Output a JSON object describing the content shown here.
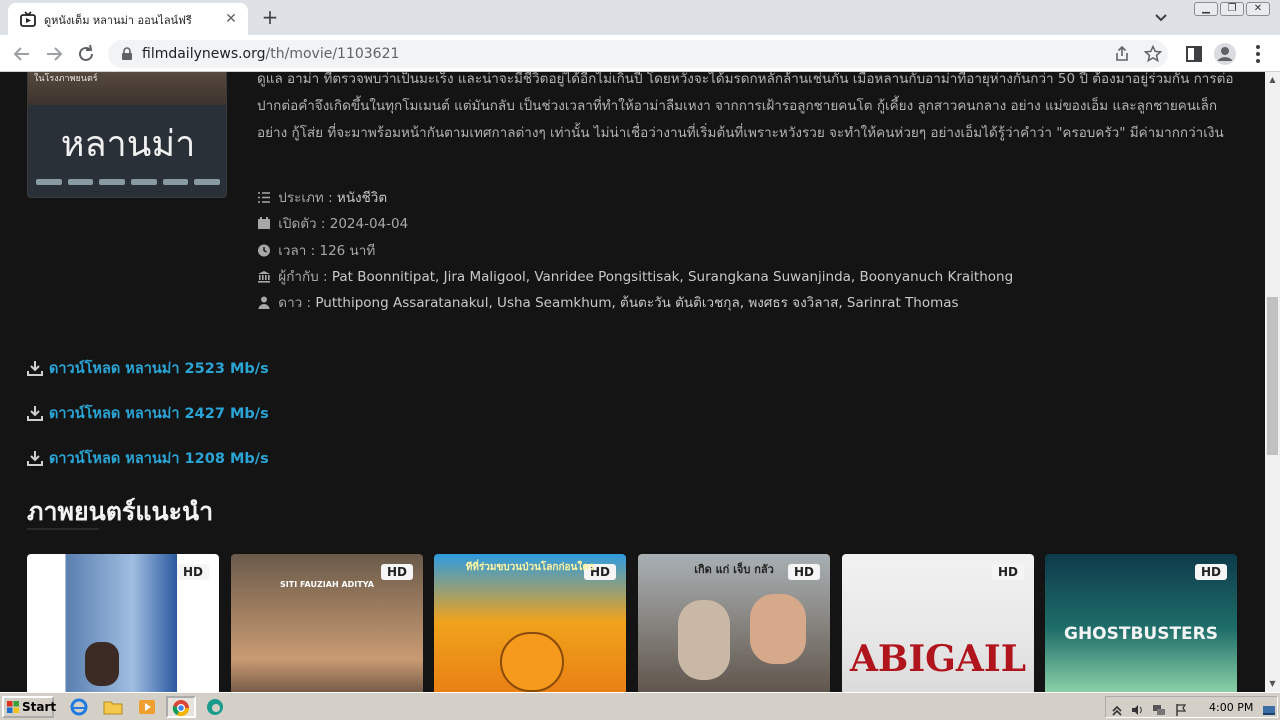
{
  "browser": {
    "tab_title": "ดูหนังเต็ม หลานม่า ออนไลน์ฟรี",
    "tab_close": "✕",
    "new_tab": "+",
    "url_domain": "filmdailynews.org",
    "url_path": "/th/movie/1103621"
  },
  "movie": {
    "poster_tag": "ในโรงภาพยนตร์",
    "poster_title": "หลานม่า",
    "synopsis": "ดูแล อาม่า ที่ตรวจพบว่าเป็นมะเร็ง และน่าจะมีชีวิตอยู่ได้อีกไม่เกินปี โดยหวังจะได้มรดกหลักล้านเช่นกัน เมื่อหลานกับอาม่าที่อายุห่างกันกว่า 50 ปี ต้องมาอยู่ร่วมกัน การต่อปากต่อคำจึงเกิดขึ้นในทุกโมเมนต์ แต่มันกลับ เป็นช่วงเวลาที่ทำให้อาม่าลืมเหงา จากการเฝ้ารอลูกชายคนโต กู้เคี้ยง ลูกสาวคนกลาง อย่าง แม่ของเอ็ม และลูกชายคนเล็กอย่าง กู้โส่ย ที่จะมาพร้อมหน้ากันตามเทศกาลต่างๆ เท่านั้น ไม่น่าเชื่อว่างานที่เริ่มต้นที่เพราะหวังรวย จะทำให้คนห่วยๆ อย่างเอ็มได้รู้ว่าคำว่า \"ครอบครัว\" มีค่ามากกว่าเงิน",
    "genre_label": "ประเภท :",
    "genre": "หนังชีวิต",
    "release_label": "เปิดตัว :",
    "release": "2024-04-04",
    "runtime_label": "เวลา :",
    "runtime": "126 นาที",
    "director_label": "ผู้กำกับ :",
    "directors": "Pat Boonnitipat, Jira Maligool, Vanridee Pongsittisak, Surangkana Suwanjinda, Boonyanuch Kraithong",
    "cast_label": "ดาว :",
    "cast": "Putthipong Assaratanakul, Usha Seamkhum, ต้นตะวัน ตันติเวชกุล, พงศธร จงวิลาส, Sarinrat Thomas"
  },
  "downloads": [
    {
      "label": "ดาวน์โหลด หลานม่า 2523 Mb/s"
    },
    {
      "label": "ดาวน์โหลด หลานม่า 2427 Mb/s"
    },
    {
      "label": "ดาวน์โหลด หลานม่า 1208 Mb/s"
    }
  ],
  "recommended": {
    "title": "ภาพยนตร์แนะนำ",
    "cards": [
      {
        "badge": "HD",
        "text": ""
      },
      {
        "badge": "HD",
        "text": "SITI FAUZIAH   ADITYA"
      },
      {
        "badge": "HD",
        "text": "ทีที่ร่วมขบวนป่วนโลกก่อนใคร"
      },
      {
        "badge": "HD",
        "text": "เกิด แก่ เจ็บ กลัว"
      },
      {
        "badge": "HD",
        "text": "ABIGAIL"
      },
      {
        "badge": "HD",
        "text": "GHOSTBUSTERS"
      }
    ]
  },
  "taskbar": {
    "start": "Start",
    "clock": "4:00 PM"
  }
}
